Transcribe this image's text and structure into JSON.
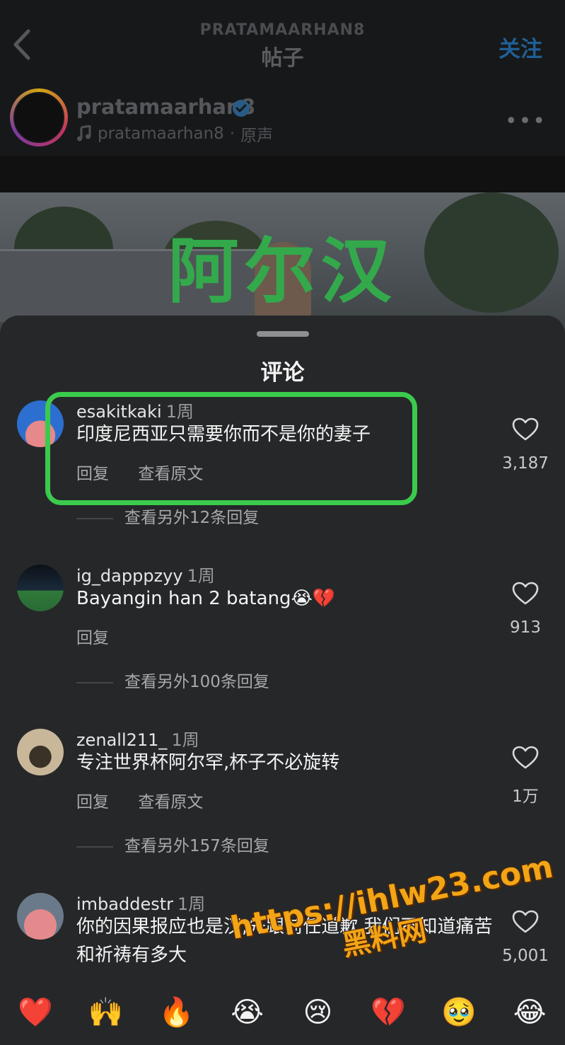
{
  "header": {
    "back_icon": "chevron-left-icon",
    "account": "PRATAMAARHAN8",
    "title": "帖子",
    "follow_label": "关注"
  },
  "post": {
    "username": "pratamaarhan8",
    "verified_icon": "verified-badge-icon",
    "music_icon": "music-note-icon",
    "audio_user": "pratamaarhan8",
    "audio_separator": "·",
    "audio_label": "原声",
    "more_icon": "more-icon",
    "image_caption": "阿尔汉"
  },
  "comments_sheet": {
    "title": "评论",
    "comments": [
      {
        "user": "esakitkaki",
        "time": "1周",
        "text": "印度尼西亚只需要你而不是你的妻子",
        "reply_label": "回复",
        "translate_label": "查看原文",
        "likes": "3,187",
        "more_replies": "查看另外12条回复"
      },
      {
        "user": "ig_dapppzyy",
        "time": "1周",
        "text": "Bayangin han 2 batang😭💔",
        "reply_label": "回复",
        "translate_label": "",
        "likes": "913",
        "more_replies": "查看另外100条回复"
      },
      {
        "user": "zenall211_",
        "time": "1周",
        "text": "专注世界杯阿尔罕,杯子不必旋转",
        "reply_label": "回复",
        "translate_label": "查看原文",
        "likes": "1万",
        "more_replies": "查看另外157条回复"
      },
      {
        "user": "imbaddestr",
        "time": "1周",
        "text": "你的因果报应也是汉,先跟前任道歉,我们不知道痛苦和祈祷有多大",
        "likes": "5,001"
      }
    ],
    "emojis": [
      "❤️",
      "🙌",
      "🔥",
      "😭",
      "😢",
      "💔",
      "🥹",
      "😂"
    ]
  },
  "watermark": {
    "url": "https://ihlw23.com",
    "label": "黑料网"
  },
  "colors": {
    "highlight": "#3acb4d",
    "follow": "#1f5f96",
    "watermark": "#f2a516"
  }
}
